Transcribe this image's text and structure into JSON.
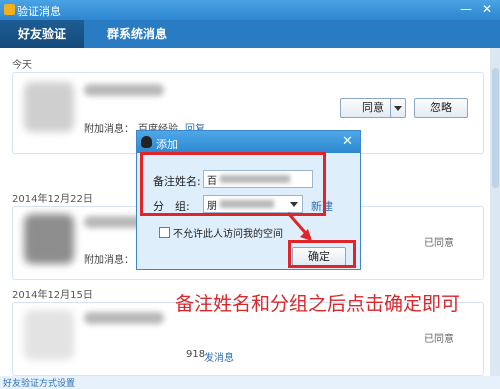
{
  "window": {
    "title": "验证消息",
    "min_icon": "minimize-icon",
    "close_icon": "close-icon"
  },
  "tabs": [
    {
      "label": "好友验证",
      "active": true
    },
    {
      "label": "群系统消息",
      "active": false
    }
  ],
  "sections": [
    {
      "date": "今天",
      "message_prefix": "附加消息：",
      "message": "百度经验",
      "reply_link": "回复",
      "accept_button": "同意",
      "ignore_button": "忽略"
    },
    {
      "date": "2014年12月22日",
      "message_prefix": "附加消息：",
      "status": "已同意"
    },
    {
      "date": "2014年12月15日",
      "message_fragment": "918",
      "send_link": "发消息",
      "status": "已同意"
    }
  ],
  "dialog": {
    "title": "添加",
    "remark_label": "备注姓名:",
    "remark_value": "百",
    "group_label": "分　组:",
    "group_value": "朋",
    "new_link": "新建",
    "privacy_label": "不允许此人访问我的空间",
    "confirm_button": "确定"
  },
  "annotation": "备注姓名和分组之后点击确定即可",
  "footer": {
    "settings_link": "好友验证方式设置"
  },
  "colors": {
    "titlebar": "#2d86cf",
    "tabbar": "#2a7cc2",
    "annotation_red": "#e0242a",
    "link": "#2d6fb3"
  }
}
